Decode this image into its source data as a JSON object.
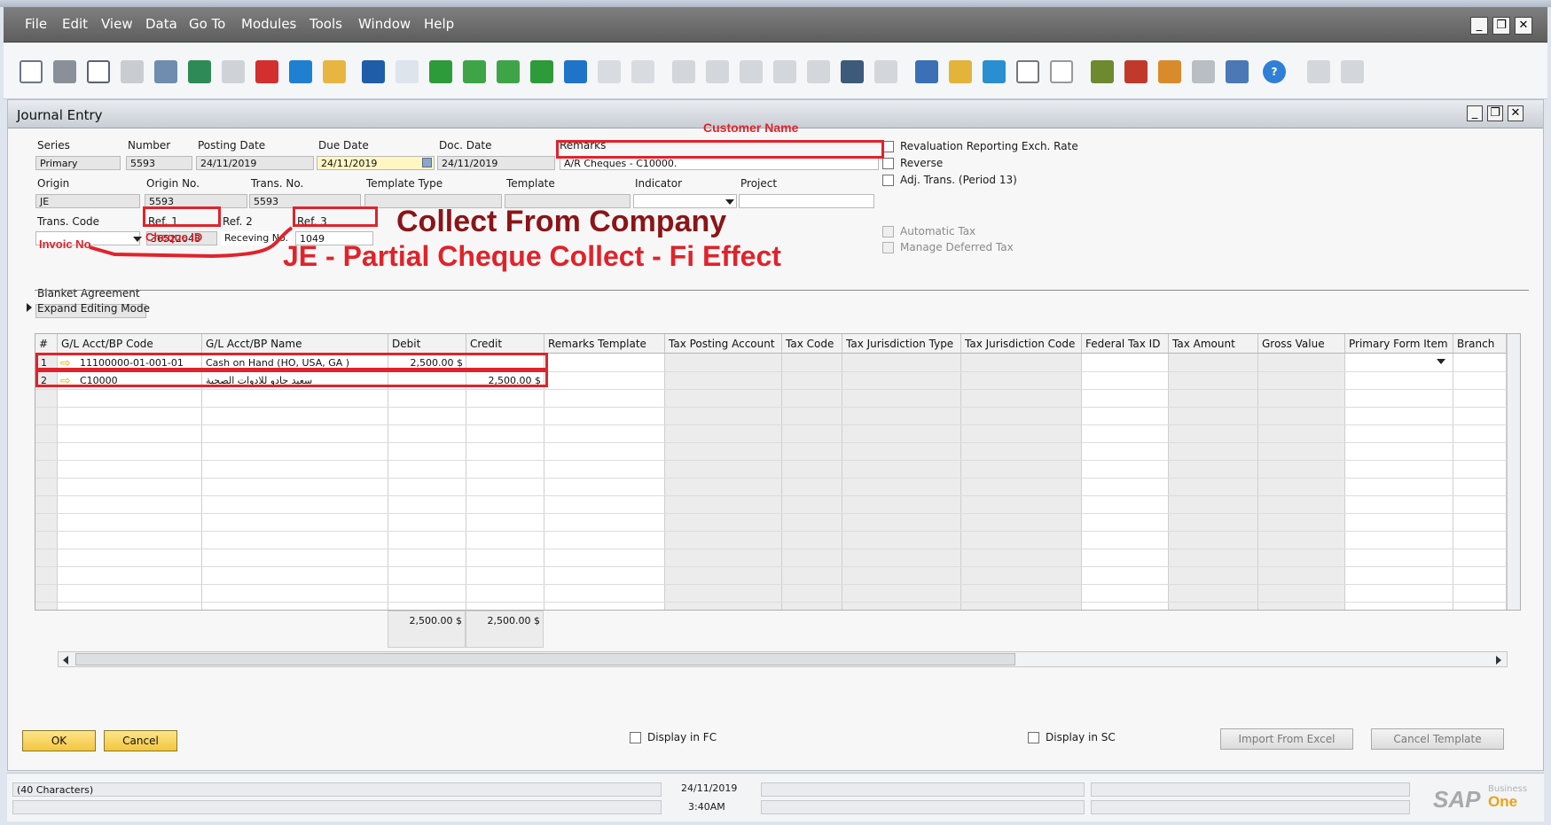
{
  "menu": [
    "File",
    "Edit",
    "View",
    "Data",
    "Go To",
    "Modules",
    "Tools",
    "Window",
    "Help"
  ],
  "window": {
    "title": "Journal Entry"
  },
  "header": {
    "labels": {
      "series": "Series",
      "number": "Number",
      "posting_date": "Posting Date",
      "due_date": "Due Date",
      "doc_date": "Doc. Date",
      "remarks": "Remarks",
      "origin": "Origin",
      "origin_no": "Origin No.",
      "trans_no": "Trans. No.",
      "template_type": "Template Type",
      "template": "Template",
      "indicator": "Indicator",
      "project": "Project",
      "trans_code": "Trans. Code",
      "ref1": "Ref. 1",
      "ref2": "Ref. 2",
      "ref3": "Ref. 3",
      "blanket": "Blanket Agreement"
    },
    "values": {
      "series": "Primary",
      "number": "5593",
      "posting_date": "24/11/2019",
      "due_date": "24/11/2019",
      "doc_date": "24/11/2019",
      "remarks": "A/R Cheques - C10000.",
      "origin": "JE",
      "origin_no": "5593",
      "trans_no": "5593",
      "ref1": "36522048",
      "ref2": "Receving No.",
      "ref3": "1049"
    },
    "checks": {
      "revaluation": "Revaluation Reporting Exch. Rate",
      "reverse": "Reverse",
      "adj": "Adj. Trans. (Period 13)",
      "auto_tax": "Automatic Tax",
      "deferred_tax": "Manage Deferred Tax"
    }
  },
  "annotations": {
    "customer_name": "Customer Name",
    "cheque_id": "Cheque ID",
    "invoice_no": "Invoic No.",
    "collect": "Collect From Company",
    "je_title": "JE - Partial Cheque Collect - Fi Effect"
  },
  "expand_label": "Expand Editing Mode",
  "grid": {
    "columns": [
      "#",
      "G/L Acct/BP Code",
      "G/L Acct/BP Name",
      "Debit",
      "Credit",
      "Remarks Template",
      "Tax Posting Account",
      "Tax Code",
      "Tax Jurisdiction Type",
      "Tax Jurisdiction Code",
      "Federal Tax ID",
      "Tax Amount",
      "Gross Value",
      "Primary Form Item",
      "Branch"
    ],
    "rows": [
      {
        "num": "1",
        "code": "11100000-01-001-01",
        "name": "Cash on Hand (HO, USA, GA )",
        "debit": "2,500.00 $",
        "credit": ""
      },
      {
        "num": "2",
        "code": "C10000",
        "name": "سعيد جادو للادوات الصحية",
        "debit": "",
        "credit": "2,500.00 $"
      }
    ],
    "totals": {
      "debit": "2,500.00 $",
      "credit": "2,500.00 $"
    }
  },
  "buttons": {
    "ok": "OK",
    "cancel": "Cancel",
    "import": "Import From Excel",
    "cancel_template": "Cancel Template"
  },
  "display_fc": "Display in FC",
  "display_sc": "Display in SC",
  "status": {
    "chars": "(40 Characters)",
    "date": "24/11/2019",
    "time": "3:40AM"
  },
  "brand": {
    "name": "SAP",
    "product1": "Business",
    "product2": "One"
  }
}
